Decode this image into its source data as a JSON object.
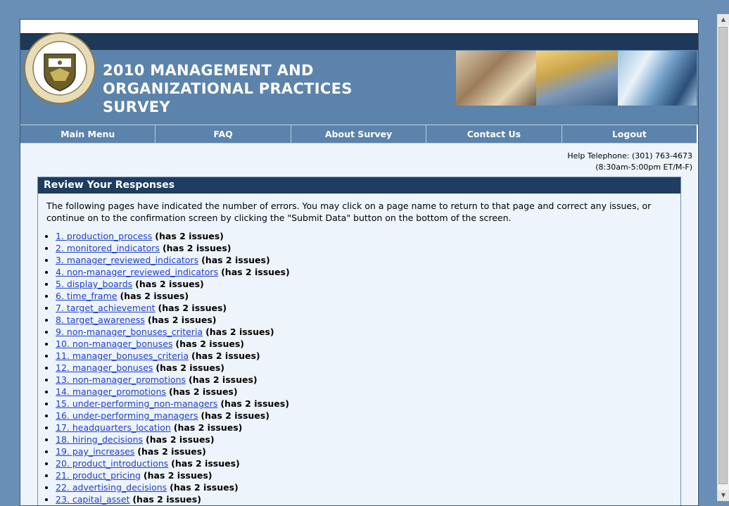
{
  "header": {
    "title": "2010 MANAGEMENT AND ORGANIZATIONAL PRACTICES SURVEY",
    "seal_text_top": "U.S. DEPARTMENT OF COMMERCE",
    "seal_text_bottom": "BUREAU OF THE CENSUS"
  },
  "nav": [
    {
      "label": "Main Menu"
    },
    {
      "label": "FAQ"
    },
    {
      "label": "About Survey"
    },
    {
      "label": "Contact Us"
    },
    {
      "label": "Logout"
    }
  ],
  "help": {
    "telephone": "Help Telephone: (301) 763-4673",
    "hours": "(8:30am-5:00pm ET/M-F)"
  },
  "panel": {
    "title": "Review Your Responses",
    "intro": "The following pages have indicated the number of errors. You may click on a page name to return to that page and correct any issues, or continue on to the confirmation screen by clicking the \"Submit Data\" button on the bottom of the screen.",
    "items": [
      {
        "link": "1. production_process",
        "status": "(has 2 issues)"
      },
      {
        "link": "2. monitored_indicators",
        "status": "(has 2 issues)"
      },
      {
        "link": "3. manager_reviewed_indicators",
        "status": "(has 2 issues)"
      },
      {
        "link": "4. non-manager_reviewed_indicators",
        "status": "(has 2 issues)"
      },
      {
        "link": "5. display_boards",
        "status": "(has 2 issues)"
      },
      {
        "link": "6. time_frame",
        "status": "(has 2 issues)"
      },
      {
        "link": "7. target_achievement",
        "status": "(has 2 issues)"
      },
      {
        "link": "8. target_awareness",
        "status": "(has 2 issues)"
      },
      {
        "link": "9. non-manager_bonuses_criteria",
        "status": "(has 2 issues)"
      },
      {
        "link": "10. non-manager_bonuses",
        "status": "(has 2 issues)"
      },
      {
        "link": "11. manager_bonuses_criteria",
        "status": "(has 2 issues)"
      },
      {
        "link": "12. manager_bonuses",
        "status": "(has 2 issues)"
      },
      {
        "link": "13. non-manager_promotions",
        "status": "(has 2 issues)"
      },
      {
        "link": "14. manager_promotions",
        "status": "(has 2 issues)"
      },
      {
        "link": "15. under-performing_non-managers",
        "status": "(has 2 issues)"
      },
      {
        "link": "16. under-performing_managers",
        "status": "(has 2 issues)"
      },
      {
        "link": "17. headquarters_location",
        "status": "(has 2 issues)"
      },
      {
        "link": "18. hiring_decisions",
        "status": "(has 2 issues)"
      },
      {
        "link": "19. pay_increases",
        "status": "(has 2 issues)"
      },
      {
        "link": "20. product_introductions",
        "status": "(has 2 issues)"
      },
      {
        "link": "21. product_pricing",
        "status": "(has 2 issues)"
      },
      {
        "link": "22. advertising_decisions",
        "status": "(has 2 issues)"
      },
      {
        "link": "23. capital_asset",
        "status": "(has 2 issues)"
      }
    ]
  },
  "colors": {
    "background": "#6a8fb6",
    "header": "#5b83ab",
    "panel_header": "#1e3d60",
    "link": "#1f3ec8"
  }
}
